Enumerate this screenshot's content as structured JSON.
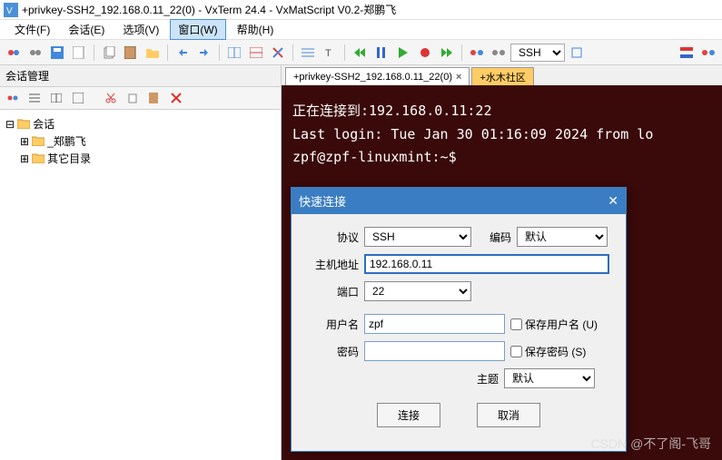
{
  "title": "+privkey-SSH2_192.168.0.11_22(0) - VxTerm 24.4 - VxMatScript V0.2-郑鹏飞",
  "menu": {
    "file": "文件(F)",
    "session": "会话(E)",
    "options": "选项(V)",
    "window": "窗口(W)",
    "help": "帮助(H)"
  },
  "toolbar": {
    "ssh_label": "SSH"
  },
  "sidebar": {
    "title": "会话管理",
    "root": "会话",
    "nodes": [
      "_郑鹏飞",
      "其它目录"
    ]
  },
  "tabs": {
    "active": "+privkey-SSH2_192.168.0.11_22(0)",
    "extra": "+水木社区"
  },
  "terminal": {
    "line1": "正在连接到:192.168.0.11:22",
    "line2": "Last login: Tue Jan 30 01:16:09 2024 from lo",
    "line3": "zpf@zpf-linuxmint:~$"
  },
  "dialog": {
    "title": "快速连接",
    "labels": {
      "protocol": "协议",
      "encoding": "编码",
      "host": "主机地址",
      "port": "端口",
      "username": "用户名",
      "password": "密码",
      "save_user": "保存用户名 (U)",
      "save_pass": "保存密码 (S)",
      "theme": "主题"
    },
    "values": {
      "protocol": "SSH",
      "encoding": "默认",
      "host": "192.168.0.11",
      "port": "22",
      "username": "zpf",
      "password": "",
      "theme": "默认"
    },
    "buttons": {
      "connect": "连接",
      "cancel": "取消"
    }
  },
  "watermark": "CSDN @不了阁-飞哥"
}
